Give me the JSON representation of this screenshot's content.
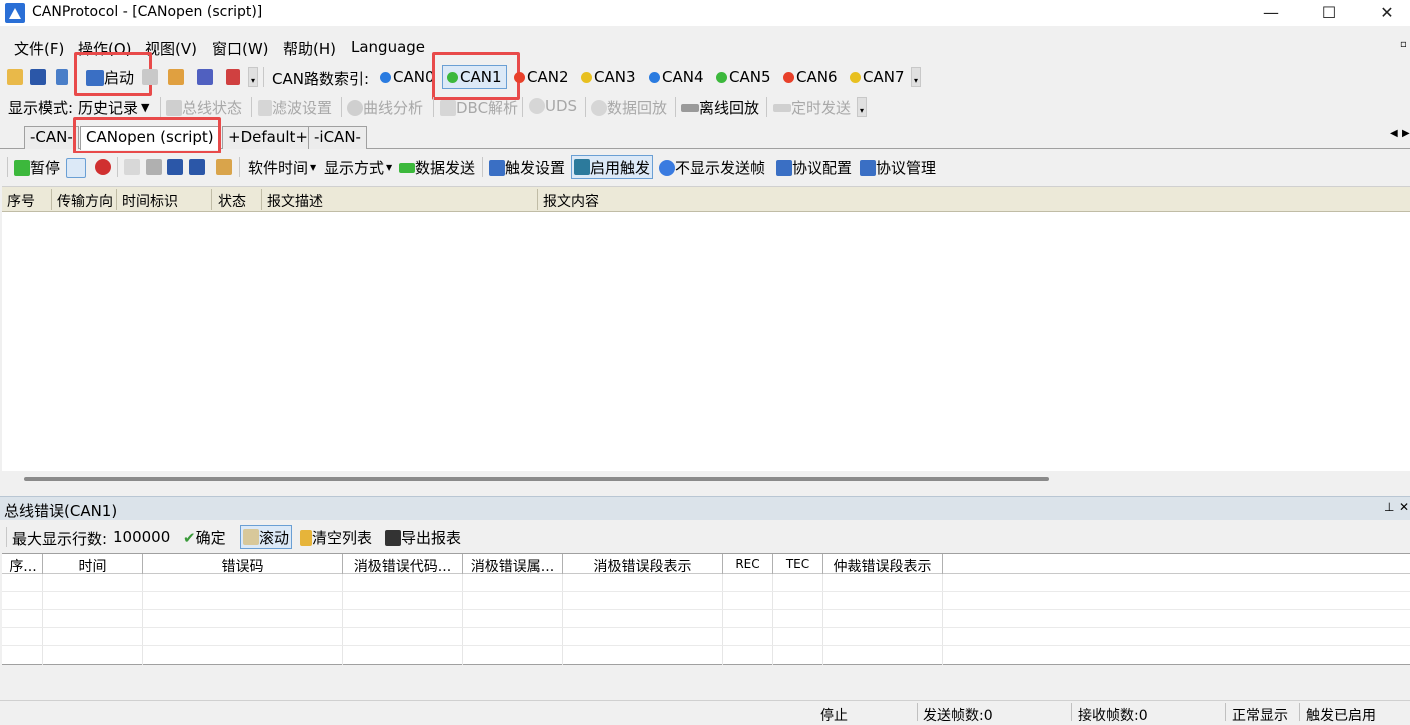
{
  "window": {
    "title": "CANProtocol - [CANopen (script)]",
    "minimize": "—",
    "maximize": "☐",
    "close": "✕"
  },
  "menu": [
    "文件(F)",
    "操作(O)",
    "视图(V)",
    "窗口(W)",
    "帮助(H)",
    "Language"
  ],
  "toolbar1": {
    "start_label": "启动",
    "can_index_label": "CAN路数索引:",
    "channels": [
      {
        "label": "CAN0",
        "color": "#2a7be0"
      },
      {
        "label": "CAN1",
        "color": "#3cb83c"
      },
      {
        "label": "CAN2",
        "color": "#e8402a"
      },
      {
        "label": "CAN3",
        "color": "#e8c020"
      },
      {
        "label": "CAN4",
        "color": "#2a7be0"
      },
      {
        "label": "CAN5",
        "color": "#3cb83c"
      },
      {
        "label": "CAN6",
        "color": "#e8402a"
      },
      {
        "label": "CAN7",
        "color": "#e8c020"
      }
    ]
  },
  "toolbar2": {
    "display_mode_label": "显示模式:",
    "display_mode_value": "历史记录",
    "bus_status": "总线状态",
    "filter": "滤波设置",
    "curve": "曲线分析",
    "dbc": "DBC解析",
    "uds": "UDS",
    "playback": "数据回放",
    "offline": "离线回放",
    "timed_send": "定时发送"
  },
  "tabs": [
    "-CAN-",
    "CANopen (script)",
    "+Default+",
    "-iCAN-"
  ],
  "toolbar3": {
    "pause": "暂停",
    "software_time": "软件时间",
    "display_method": "显示方式",
    "data_send": "数据发送",
    "trigger_setting": "触发设置",
    "enable_trigger": "启用触发",
    "hide_send_frames": "不显示发送帧",
    "protocol_config": "协议配置",
    "protocol_manage": "协议管理"
  },
  "grid1": {
    "columns": [
      "序号",
      "传输方向",
      "时间标识",
      "状态",
      "报文描述",
      "报文内容"
    ]
  },
  "panel": {
    "title": "总线错误(CAN1)",
    "max_rows_label": "最大显示行数:",
    "max_rows_value": "100000",
    "confirm": "确定",
    "scroll": "滚动",
    "clear": "清空列表",
    "export": "导出报表"
  },
  "grid2": {
    "columns": [
      "序...",
      "时间",
      "错误码",
      "消极错误代码...",
      "消极错误属...",
      "消极错误段表示",
      "REC",
      "TEC",
      "仲裁错误段表示"
    ]
  },
  "status": {
    "state": "停止",
    "send_frames": "发送帧数:0",
    "recv_frames": "接收帧数:0",
    "display": "正常显示",
    "trigger": "触发已启用"
  }
}
